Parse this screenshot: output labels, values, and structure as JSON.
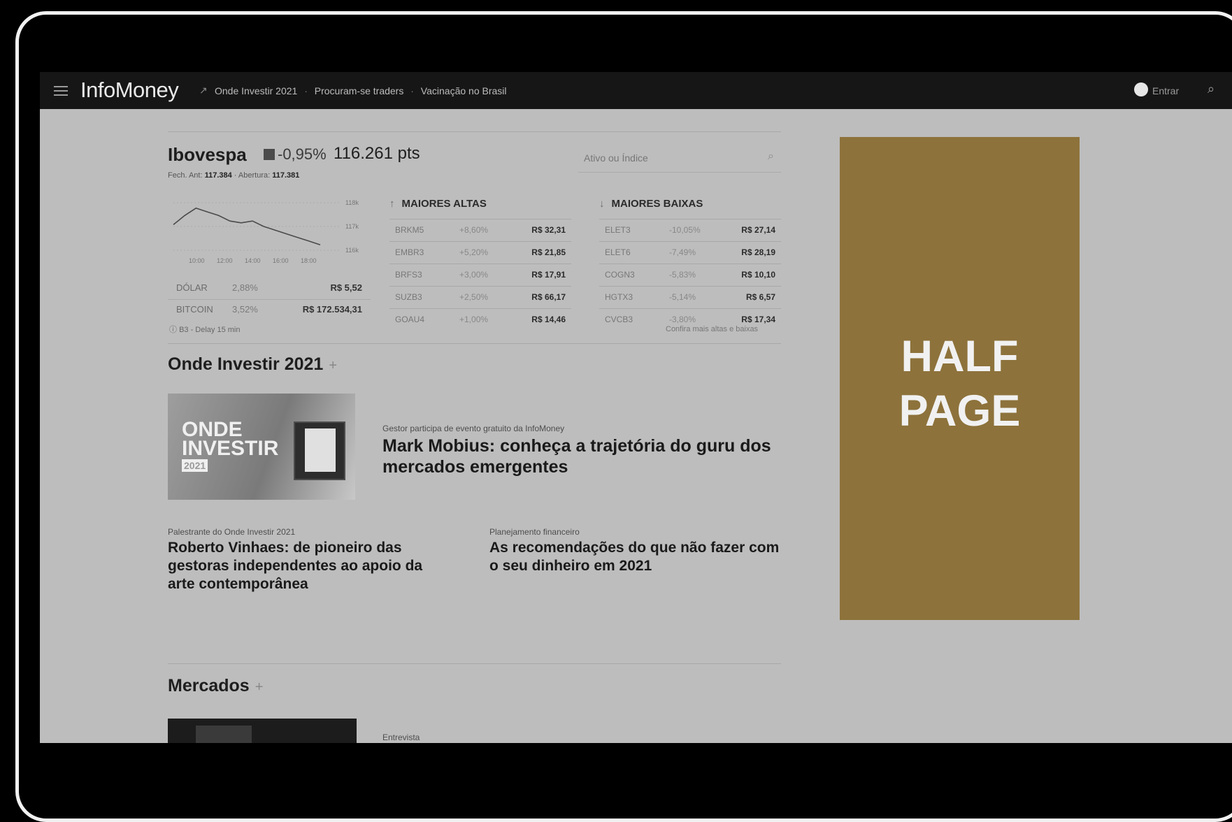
{
  "topbar": {
    "logo": "InfoMoney",
    "nav_links": [
      "Onde Investir 2021",
      "Procuram-se traders",
      "Vacinação no Brasil"
    ],
    "nav_sep": "·",
    "login_label": "Entrar"
  },
  "ibovespa": {
    "title": "Ibovespa",
    "variation": "-0,95%",
    "points": "116.261 pts",
    "sub_close_label": "Fech. Ant:",
    "sub_close_value": "117.384",
    "sub_open_label": "Abertura:",
    "sub_open_value": "117.381",
    "search_placeholder": "Ativo ou Índice"
  },
  "chart_data": {
    "type": "line",
    "title": "",
    "x": [
      "10:00",
      "12:00",
      "14:00",
      "16:00",
      "18:00"
    ],
    "y_ticks": [
      "118k",
      "117k",
      "116k"
    ],
    "series": [
      {
        "values": [
          117.4,
          117.9,
          118.3,
          118.1,
          117.9,
          117.6,
          117.5,
          117.6,
          117.3,
          117.1,
          116.9,
          116.7,
          116.5,
          116.3
        ]
      }
    ],
    "ylim": [
      116,
      118.6
    ]
  },
  "fx": [
    {
      "name": "DÓLAR",
      "pct": "2,88%",
      "value": "R$ 5,52"
    },
    {
      "name": "BITCOIN",
      "pct": "3,52%",
      "value": "R$ 172.534,31"
    }
  ],
  "delay_note": "B3 - Delay 15 min",
  "gainers": {
    "title": "MAIORES ALTAS",
    "rows": [
      {
        "ticker": "BRKM5",
        "pct": "+8,60%",
        "value": "R$ 32,31"
      },
      {
        "ticker": "EMBR3",
        "pct": "+5,20%",
        "value": "R$ 21,85"
      },
      {
        "ticker": "BRFS3",
        "pct": "+3,00%",
        "value": "R$ 17,91"
      },
      {
        "ticker": "SUZB3",
        "pct": "+2,50%",
        "value": "R$ 66,17"
      },
      {
        "ticker": "GOAU4",
        "pct": "+1,00%",
        "value": "R$ 14,46"
      }
    ]
  },
  "losers": {
    "title": "MAIORES BAIXAS",
    "rows": [
      {
        "ticker": "ELET3",
        "pct": "-10,05%",
        "value": "R$ 27,14"
      },
      {
        "ticker": "ELET6",
        "pct": "-7,49%",
        "value": "R$ 28,19"
      },
      {
        "ticker": "COGN3",
        "pct": "-5,83%",
        "value": "R$ 10,10"
      },
      {
        "ticker": "HGTX3",
        "pct": "-5,14%",
        "value": "R$ 6,57"
      },
      {
        "ticker": "CVCB3",
        "pct": "-3,80%",
        "value": "R$ 17,34"
      }
    ]
  },
  "more_link": "Confira mais altas e baixas",
  "section_onde": {
    "title": "Onde Investir 2021",
    "plus": "+",
    "banner_line1": "ONDE",
    "banner_line2": "INVESTIR",
    "banner_year": "2021",
    "main_kicker": "Gestor participa de evento gratuito da InfoMoney",
    "main_headline": "Mark Mobius: conheça a trajetória do guru dos mercados emergentes",
    "left_kicker": "Palestrante do Onde Investir 2021",
    "left_headline": "Roberto Vinhaes: de pioneiro das gestoras independentes ao apoio da arte contemporânea",
    "right_kicker": "Planejamento financeiro",
    "right_headline": "As recomendações do que não fazer com o seu dinheiro em 2021"
  },
  "section_mercados": {
    "title": "Mercados",
    "plus": "+",
    "kicker": "Entrevista"
  },
  "ad": {
    "line1": "HALF",
    "line2": "PAGE",
    "color": "#8d723b"
  }
}
